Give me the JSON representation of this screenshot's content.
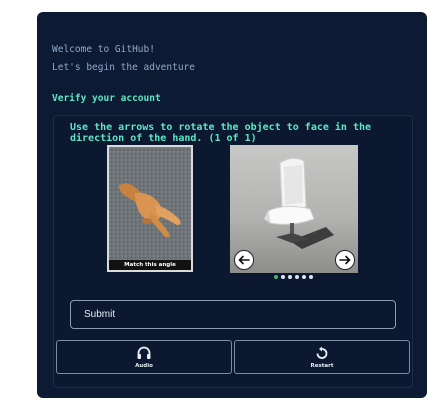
{
  "header": {
    "welcome_line": "Welcome to GitHub!",
    "begin_line": "Let's begin the adventure"
  },
  "verify": {
    "heading": "Verify your account"
  },
  "challenge": {
    "instruction": "Use the arrows to rotate the object to face in the direction of the hand. (1 of 1)",
    "reference_caption": "Match this angle",
    "dots_total": 6,
    "dots_active_index": 0
  },
  "buttons": {
    "submit": "Submit",
    "audio": "Audio",
    "restart": "Restart"
  },
  "icons": {
    "left": "arrow-left-icon",
    "right": "arrow-right-icon",
    "audio": "headphones-icon",
    "restart": "restart-icon"
  },
  "colors": {
    "card_bg": "#0d1a33",
    "accent": "#5ee7c4",
    "dot_active": "#3dbb6e"
  }
}
